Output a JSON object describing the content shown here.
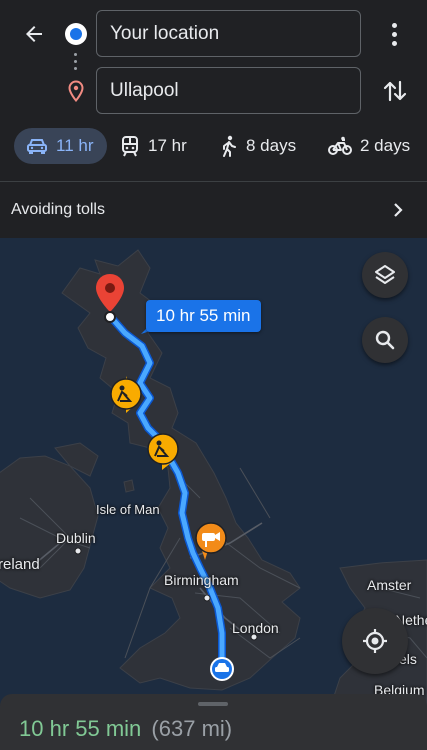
{
  "header": {
    "origin_value": "Your location",
    "destination_value": "Ullapool"
  },
  "modes": [
    {
      "icon": "car-icon",
      "label": "11 hr",
      "selected": true
    },
    {
      "icon": "train-icon",
      "label": "17 hr",
      "selected": false
    },
    {
      "icon": "walking-icon",
      "label": "8 days",
      "selected": false
    },
    {
      "icon": "bicycle-icon",
      "label": "2 days",
      "selected": false
    }
  ],
  "options": {
    "avoid_label": "Avoiding tolls"
  },
  "map": {
    "route_time_chip": "10 hr 55 min",
    "labels": {
      "isle_of_man": "Isle of Man",
      "dublin": "Dublin",
      "ireland": "reland",
      "birmingham": "Birmingham",
      "london": "London",
      "amsterdam": "Amster",
      "netherlands": "Nethe",
      "brussels": "els",
      "belgium": "Belgium"
    },
    "route_color": "#4aa8ff",
    "incident_icons": [
      "roadworks-icon",
      "roadworks-icon",
      "speed-camera-icon"
    ]
  },
  "summary": {
    "duration": "10 hr 55 min",
    "distance": "(637 mi)"
  },
  "colors": {
    "accent": "#1a73e8",
    "duration_green": "#81c995",
    "selected_mode_bg": "#394457"
  }
}
